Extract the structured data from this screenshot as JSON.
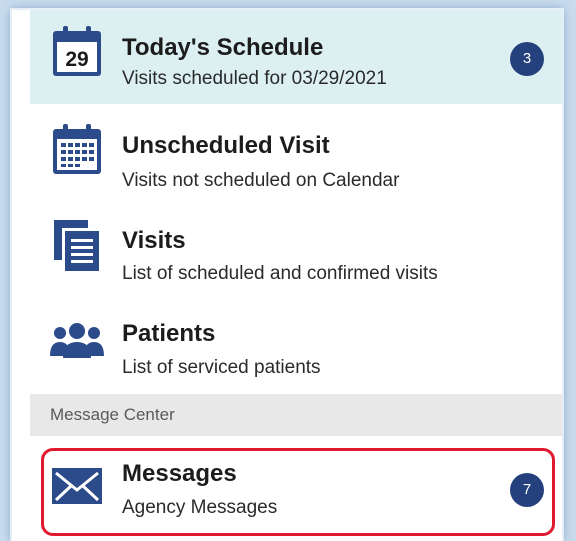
{
  "menu": {
    "items": [
      {
        "title": "Today's Schedule",
        "subtitle": "Visits scheduled for 03/29/2021",
        "icon": "calendar-date-icon",
        "icon_text": "29",
        "badge": "3"
      },
      {
        "title": "Unscheduled Visit",
        "subtitle": "Visits not scheduled on Calendar",
        "icon": "calendar-grid-icon"
      },
      {
        "title": "Visits",
        "subtitle": "List of scheduled and confirmed visits",
        "icon": "document-list-icon"
      },
      {
        "title": "Patients",
        "subtitle": "List of serviced patients",
        "icon": "people-group-icon"
      }
    ]
  },
  "message_center": {
    "header": "Message Center",
    "items": [
      {
        "title": "Messages",
        "subtitle": "Agency Messages",
        "icon": "envelope-icon",
        "badge": "7"
      }
    ]
  },
  "colors": {
    "icon_blue": "#2c4b8a",
    "badge_bg": "#25417d",
    "highlight_bg": "#dcf0f2",
    "section_bg": "#e8e8e8",
    "annotation_red": "#e0192f"
  }
}
